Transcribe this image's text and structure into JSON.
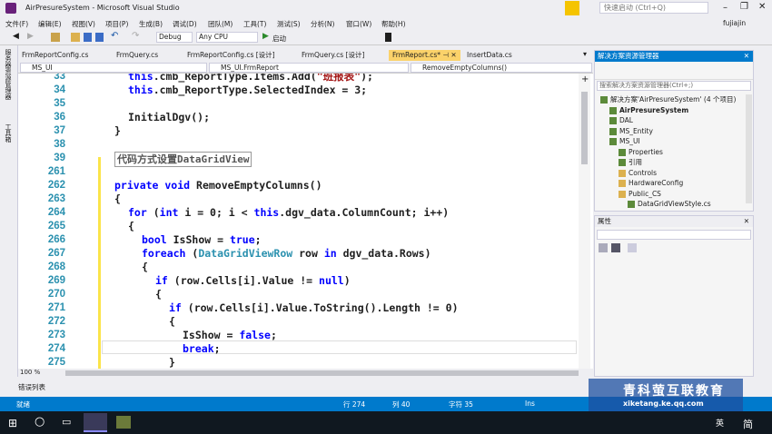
{
  "window": {
    "title": "AirPresureSystem - Microsoft Visual Studio",
    "quick_launch": "快速启动 (Ctrl+Q)",
    "user": "fujiajin"
  },
  "menu": [
    "文件(F)",
    "编辑(E)",
    "视图(V)",
    "项目(P)",
    "生成(B)",
    "调试(D)",
    "团队(M)",
    "工具(T)",
    "测试(S)",
    "分析(N)",
    "窗口(W)",
    "帮助(H)"
  ],
  "toolbar": {
    "config": "Debug",
    "platform": "Any CPU",
    "start": "启动"
  },
  "left_strip": [
    "服务器资源管理器",
    "工具箱"
  ],
  "tabs": [
    {
      "label": "FrmReportConfig.cs",
      "active": false
    },
    {
      "label": "FrmQuery.cs",
      "active": false
    },
    {
      "label": "FrmReportConfig.cs [设计]",
      "active": false
    },
    {
      "label": "FrmQuery.cs [设计]",
      "active": false
    },
    {
      "label": "FrmReport.cs*",
      "active": true
    },
    {
      "label": "InsertData.cs",
      "active": false
    }
  ],
  "navbar": {
    "project": "MS_UI",
    "class": "MS_UI.FrmReport",
    "member": "RemoveEmptyColumns()"
  },
  "code": [
    {
      "n": "33",
      "indent": 1,
      "parts": [
        [
          "this",
          "kw"
        ],
        [
          ".cmb_ReportType.Items.Add(",
          ""
        ],
        [
          "\"班报表\"",
          "str"
        ],
        [
          ");",
          ""
        ]
      ]
    },
    {
      "n": "34",
      "indent": 1,
      "parts": [
        [
          "this",
          "kw"
        ],
        [
          ".cmb_ReportType.SelectedIndex = 3;",
          ""
        ]
      ]
    },
    {
      "n": "35",
      "indent": 1,
      "parts": []
    },
    {
      "n": "36",
      "indent": 1,
      "parts": [
        [
          "InitialDgv();",
          ""
        ]
      ]
    },
    {
      "n": "37",
      "indent": 0,
      "parts": [
        [
          "}",
          ""
        ]
      ]
    },
    {
      "n": "38",
      "indent": 0,
      "parts": []
    },
    {
      "n": "39",
      "indent": 0,
      "region": true,
      "parts": [
        [
          "代码方式设置DataGridView",
          ""
        ]
      ]
    },
    {
      "n": "261",
      "indent": 0,
      "parts": []
    },
    {
      "n": "262",
      "indent": 0,
      "parts": [
        [
          "private void ",
          "kw"
        ],
        [
          "RemoveEmptyColumns()",
          ""
        ]
      ]
    },
    {
      "n": "263",
      "indent": 0,
      "parts": [
        [
          "{",
          ""
        ]
      ]
    },
    {
      "n": "264",
      "indent": 1,
      "parts": [
        [
          "for ",
          "kw"
        ],
        [
          "(",
          ""
        ],
        [
          "int ",
          "kw"
        ],
        [
          "i = 0; i < ",
          ""
        ],
        [
          "this",
          "kw"
        ],
        [
          ".dgv_data.ColumnCount; i++)",
          ""
        ]
      ]
    },
    {
      "n": "265",
      "indent": 1,
      "parts": [
        [
          "{",
          ""
        ]
      ]
    },
    {
      "n": "266",
      "indent": 2,
      "parts": [
        [
          "bool ",
          "kw"
        ],
        [
          "IsShow = ",
          ""
        ],
        [
          "true",
          "kw"
        ],
        [
          ";",
          ""
        ]
      ]
    },
    {
      "n": "267",
      "indent": 2,
      "parts": [
        [
          "foreach ",
          "kw"
        ],
        [
          "(",
          ""
        ],
        [
          "DataGridViewRow ",
          "ty"
        ],
        [
          "row ",
          ""
        ],
        [
          "in ",
          "kw"
        ],
        [
          "dgv_data.Rows)",
          ""
        ]
      ]
    },
    {
      "n": "268",
      "indent": 2,
      "parts": [
        [
          "{",
          ""
        ]
      ]
    },
    {
      "n": "269",
      "indent": 3,
      "parts": [
        [
          "if ",
          "kw"
        ],
        [
          "(row.Cells[i].Value != ",
          ""
        ],
        [
          "null",
          "kw"
        ],
        [
          ")",
          ""
        ]
      ]
    },
    {
      "n": "270",
      "indent": 3,
      "parts": [
        [
          "{",
          ""
        ]
      ]
    },
    {
      "n": "271",
      "indent": 4,
      "parts": [
        [
          "if ",
          "kw"
        ],
        [
          "(row.Cells[i].Value.ToString().Length != 0)",
          ""
        ]
      ]
    },
    {
      "n": "272",
      "indent": 4,
      "parts": [
        [
          "{",
          ""
        ]
      ]
    },
    {
      "n": "273",
      "indent": 5,
      "parts": [
        [
          "IsShow = ",
          ""
        ],
        [
          "false",
          "kw"
        ],
        [
          ";",
          ""
        ]
      ]
    },
    {
      "n": "274",
      "indent": 5,
      "parts": [
        [
          "break",
          "kw"
        ],
        [
          ";",
          ""
        ]
      ]
    },
    {
      "n": "275",
      "indent": 4,
      "parts": [
        [
          "}",
          ""
        ]
      ]
    }
  ],
  "zoom": "100 %",
  "solution": {
    "title": "解决方案资源管理器",
    "search_placeholder": "搜索解决方案资源管理器(Ctrl+;)",
    "items": [
      {
        "label": "解决方案'AirPresureSystem' (4 个项目)",
        "level": 0,
        "bold": false
      },
      {
        "label": "AirPresureSystem",
        "level": 1,
        "bold": true
      },
      {
        "label": "DAL",
        "level": 1,
        "bold": false
      },
      {
        "label": "MS_Entity",
        "level": 1,
        "bold": false
      },
      {
        "label": "MS_UI",
        "level": 1,
        "bold": false
      },
      {
        "label": "Properties",
        "level": 2,
        "bold": false
      },
      {
        "label": "引用",
        "level": 2,
        "bold": false
      },
      {
        "label": "Controls",
        "level": 2,
        "bold": false
      },
      {
        "label": "HardwareConfig",
        "level": 2,
        "bold": false
      },
      {
        "label": "Public_CS",
        "level": 2,
        "bold": false
      },
      {
        "label": "DataGridViewStyle.cs",
        "level": 3,
        "bold": false
      }
    ]
  },
  "properties": {
    "title": "属性"
  },
  "error_list": "错误列表",
  "status": {
    "ready": "就绪",
    "line": "行 274",
    "col": "列 40",
    "char": "字符 35",
    "mode": "Ins"
  },
  "watermark": {
    "text": "青科萤互联教育",
    "url": "xiketang.ke.qq.com"
  },
  "taskbar": {
    "ime": "英",
    "ime2": "简",
    "lang": "英"
  },
  "colors": {
    "accent": "#007acc",
    "active_tab": "#fbd26a",
    "keyword": "#0000ff",
    "type": "#2b91af",
    "string": "#a31515",
    "line_number": "#2b91af"
  }
}
